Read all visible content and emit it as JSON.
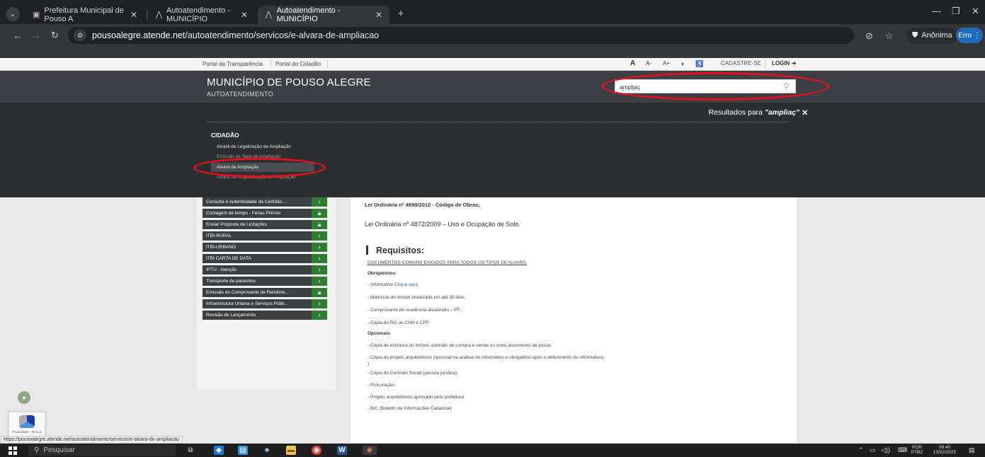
{
  "browser": {
    "tabs": [
      {
        "label": "Prefeitura Municipal de Pouso A"
      },
      {
        "label": "Autoatendimento - MUNICÍPIO"
      },
      {
        "label": "Autoatendimento - MUNICÍPIO"
      }
    ],
    "new_tab": "+",
    "url_domain": "pousoalegre.atende.net",
    "url_path": "/autoatendimento/servicos/e-alvara-de-ampliacao",
    "incognito_label": "Anônima",
    "error_label": "Erro"
  },
  "page": {
    "top_links": [
      "Portal da Transparência",
      "Portal do Cidadão"
    ],
    "accessibility": [
      "A",
      "A-",
      "A+"
    ],
    "register_label": "CADASTRE-SE",
    "login_label": "LOGIN",
    "site_title": "MUNICÍPIO DE POUSO ALEGRE",
    "site_subtitle": "AUTOATENDIMENTO",
    "search_value": "ampliaç",
    "results_prefix": "Resultados para ",
    "results_term": "\"ampliaç\"",
    "results_close": "✕",
    "category": "CIDADÃO",
    "results": [
      "Alvará de Legalização de Ampliação",
      "Emissão de Taxa de Ampliação",
      "Alvará de Ampliação",
      "Alvará de Regularização de Ampliação"
    ],
    "sidebar": [
      {
        "label": "Consulta e Autenticidade da Certidão ...",
        "icon": "chevron"
      },
      {
        "label": "Contagem de tempo - Férias Prêmio",
        "icon": "lock"
      },
      {
        "label": "Enviar Proposta de Licitações",
        "icon": "lock"
      },
      {
        "label": "ITBI-RURAL",
        "icon": "chevron"
      },
      {
        "label": "ITBI-URBANO",
        "icon": "chevron"
      },
      {
        "label": "ITBI CARTA DE DATA",
        "icon": "chevron"
      },
      {
        "label": "IPTU - Isenção",
        "icon": "chevron"
      },
      {
        "label": "Transporte de pacientes",
        "icon": "chevron"
      },
      {
        "label": "Emissão do Comprovante de Rendime...",
        "icon": "lock"
      },
      {
        "label": "Infraestrutura Urbana e Serviços Públi...",
        "icon": "chevron"
      },
      {
        "label": "Revisão de Lançamento",
        "icon": "chevron"
      }
    ],
    "content": {
      "law1": "Lei Ordinária nº 4890/2010 - Código de Obras;",
      "law2": "Lei Ordinária nº 4872/2009 – Uso e Ocupação de Solo.",
      "requirements_title": "Requisitos:",
      "docs_heading": "DOCUMENTOS COMUNS EXIGIDOS PARA TODOS OS TIPOS DE ALVARÁ:",
      "mandatory_label": "Obrigatórios:",
      "informativo_prefix": "- Informativo ",
      "informativo_link": "Clique aqui.",
      "mandatory": [
        "- Matrícula do imóvel atualizada em até 30 dias;",
        "- Comprovante de residência atualizado – PF;",
        "- Cópia do RG ou CNH e CPF."
      ],
      "optional_label": "Opcionais:",
      "optional": [
        "- Cópia de escritura do imóvel, contrato de compra e venda ou outro documento de posse;",
        "- Cópia do projeto arquitetônico (opcional na análise do informativo e obrigatório após o deferimento do informativo).",
        ")",
        "- Cópia do Contrato Social (pessoa jurídica);",
        "- Procuração;",
        "- Projeto arquitetônico aprovado pela prefeitura;",
        "- BIC (Boletim de Informações Cadastral)"
      ]
    }
  },
  "recaptcha_text": "Privacidade - Termos",
  "status_url": "https://pousoalegre.atende.net/autoatendimento/servicos/e-alvara-de-ampliacao",
  "taskbar": {
    "search_placeholder": "Pesquisar",
    "lang_top": "POR",
    "lang_bottom": "PTB2",
    "time": "08:40",
    "date": "13/02/2025"
  },
  "colors": {
    "annotation_ring": "#e6101b",
    "action_green": "#2e7d32",
    "header_bg": "#3c3f44"
  }
}
